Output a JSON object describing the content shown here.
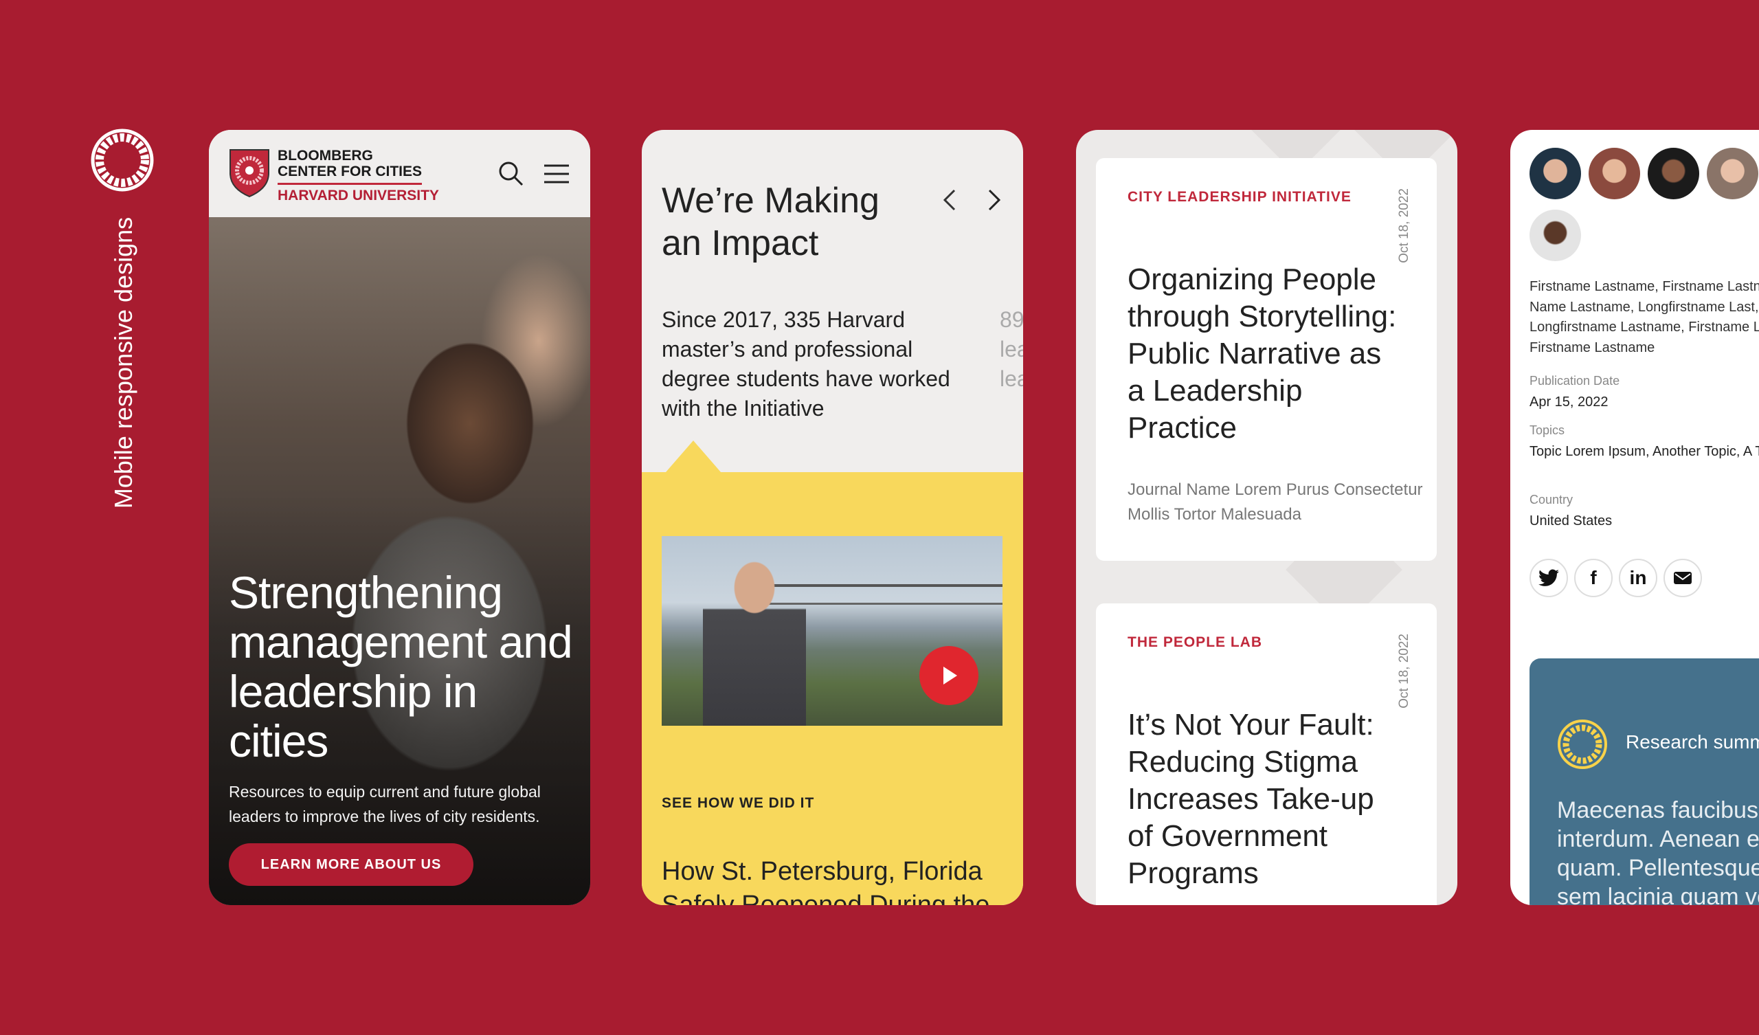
{
  "side_label": "Mobile responsive designs",
  "colors": {
    "background": "#a81c30",
    "accent": "#c0283b",
    "yellow": "#f8d85c",
    "blue": "#45718c"
  },
  "card1": {
    "logo": {
      "line1": "BLOOMBERG",
      "line2": "CENTER FOR CITIES",
      "line3": "HARVARD UNIVERSITY"
    },
    "icons": [
      "search-icon",
      "menu-icon"
    ],
    "headline": "Strengthening management and leadership in cities",
    "subtext": "Resources to equip current and future global leaders to improve the lives of city residents.",
    "button": "LEARN MORE ABOUT US"
  },
  "card2": {
    "title": "We’re Making an Impact",
    "paragraph": "Since 2017, 335 Harvard master’s and professional degree students have worked with the Initiative",
    "next_slide_partial": [
      "89",
      "lea",
      "lea"
    ],
    "eyebrow": "SEE HOW WE DID IT",
    "story_title": "How St. Petersburg, Florida Safely Reopened During the"
  },
  "card3": {
    "items": [
      {
        "category": "CITY LEADERSHIP INITIATIVE",
        "date": "Oct 18, 2022",
        "title": "Organizing People through Storytelling: Public Narrative as a Leadership Practice",
        "journal": "Journal Name Lorem Purus Consectetur Mollis Tortor Malesuada"
      },
      {
        "category": "THE PEOPLE LAB",
        "date": "Oct 18, 2022",
        "title": "It’s Not Your Fault: Reducing Stigma Increases Take-up of Government Programs"
      }
    ]
  },
  "card4": {
    "authors": [
      "Firstname Lastname, Firstname Lastname,",
      "Name Lastname, Longfirstname Last,",
      "Longfirstname Lastname, Firstname Lastname,",
      "Firstname Lastname"
    ],
    "publication_date_label": "Publication Date",
    "publication_date": "Apr 15, 2022",
    "topics_label": "Topics",
    "topics": "Topic Lorem Ipsum, Another Topic, A Topic",
    "country_label": "Country",
    "country": "United States",
    "social": [
      {
        "icon": "twitter-icon",
        "text": "🐦"
      },
      {
        "icon": "facebook-icon",
        "text": "f"
      },
      {
        "icon": "linkedin-icon",
        "text": "in"
      },
      {
        "icon": "email-icon",
        "text": "✉"
      }
    ],
    "research_title": "Research summary",
    "research_body": [
      "Maecenas faucibus mollis",
      "interdum. Aenean eu leo",
      "quam. Pellentesque ornare",
      "sem lacinia quam venenatis"
    ]
  }
}
